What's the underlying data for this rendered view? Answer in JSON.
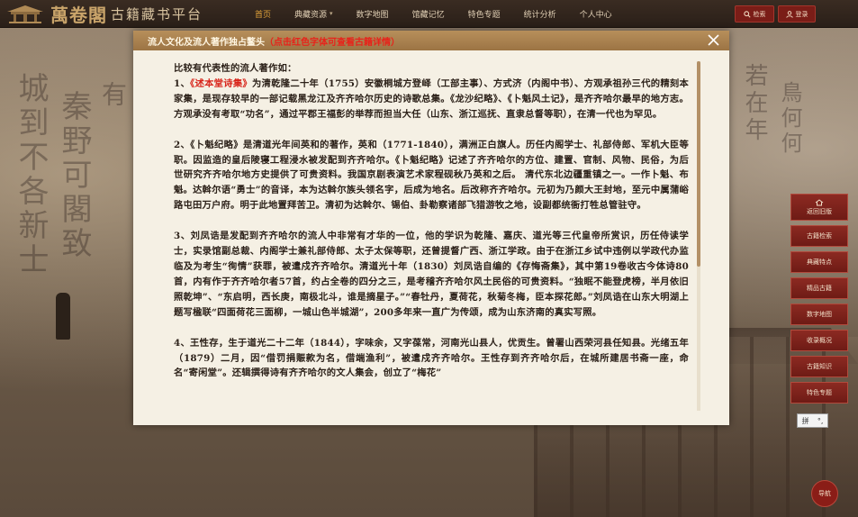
{
  "app": {
    "logo_seal": "萬卷閣",
    "logo_text": "古籍藏书平台"
  },
  "nav": {
    "items": [
      {
        "label": "首页",
        "active": true,
        "dropdown": false
      },
      {
        "label": "典藏资源",
        "active": false,
        "dropdown": true
      },
      {
        "label": "数字地图",
        "active": false,
        "dropdown": false
      },
      {
        "label": "馆藏记忆",
        "active": false,
        "dropdown": false
      },
      {
        "label": "特色专题",
        "active": false,
        "dropdown": false
      },
      {
        "label": "统计分析",
        "active": false,
        "dropdown": false
      },
      {
        "label": "个人中心",
        "active": false,
        "dropdown": false
      }
    ],
    "search_label": "检索",
    "login_label": "登录"
  },
  "side_menu": [
    "返回旧版",
    "古籍检索",
    "典藏特点",
    "精品古籍",
    "数字地图",
    "收录概况",
    "古籍知识",
    "特色专题"
  ],
  "nav_circle_label": "导航",
  "ime": {
    "char": "拼",
    "mark": "°,"
  },
  "modal": {
    "title": "流人文化及流人著作独占鳌头",
    "hint": "（点击红色字体可查看古籍详情）",
    "intro": "比较有代表性的流人著作如：",
    "p1_prefix": "1、",
    "p1_link": "《述本堂诗集》",
    "p1_rest": "为清乾隆二十年（1755）安徽桐城方登峄（工部主事）、方式济（内阁中书）、方观承祖孙三代的精刻本家集，是现存较早的一部记载黑龙江及齐齐哈尔历史的诗歌总集。《龙沙纪略》、《卜魁风土记》，是齐齐哈尔最早的地方志。方观承没有考取“功名”，通过平郡王福彭的举荐而担当大任（山东、浙江巡抚、直隶总督等职），在清一代也为罕见。",
    "p2": "2、《卜魁纪略》是清道光年间英和的著作，英和（1771-1840），满洲正白旗人。历任内阁学士、礼部侍郎、军机大臣等职。因监造的皇后陵寝工程浸水被发配到齐齐哈尔。《卜魁纪略》记述了齐齐哈尔的方位、建置、官制、风物、民俗，为后世研究齐齐哈尔地方史提供了可贵资料。我国京剧表演艺术家程砚秋乃英和之后。 清代东北边疆重镇之一。一作卜魁、布魁。达斡尔语“勇士”的音译，本为达斡尔族头领名字，后成为地名。后改称齐齐哈尔。元初为乃颜大王封地，至元中属蒲峪路屯田万户府。明于此地置拜苦卫。清初为达斡尔、锡伯、卦勒察诸部飞猎游牧之地，设副都统衙打牲总管驻守。",
    "p3": "3、刘凤诰是发配到齐齐哈尔的流人中非常有才华的一位，他的学识为乾隆、嘉庆、道光等三代皇帝所赏识，历任侍读学士，实录馆副总裁、内阁学士兼礼部侍郎、太子太保等职，还曾提督广西、浙江学政。由于在浙江乡试中违例以学政代办监临及为考生“徇情”获罪，被遣戍齐齐哈尔。清道光十年（1830）刘凤诰自编的《存悔斋集》，其中第19卷收古今体诗80首，内有作于齐齐哈尔者57首，约占全卷的四分之三，是考稽齐齐哈尔风土民俗的可贵资料。“独眠不能登虎榜，半月依旧照乾坤”、“东启明，西长庚，南极北斗，谁是摘星子。”“春牡丹，夏荷花，秋菊冬梅，臣本探花郎。”刘凤诰在山东大明湖上题写楹联“四面荷花三面柳，一城山色半城湖”，200多年来一直广为传颂，成为山东济南的真实写照。",
    "p4": "4、王性存，生于道光二十二年（1844），字味余，又字葆常，河南光山县人，优贡生。曾署山西荣河县任知县。光绪五年（1879）二月，因“借罚捐赈款为名，借端渔利”，被遣戍齐齐哈尔。王性存到齐齐哈尔后，在城所建居书斋一座，命名“寄闲堂”。还辑撰得诗有齐齐哈尔的文人集会，创立了“梅花”"
  }
}
